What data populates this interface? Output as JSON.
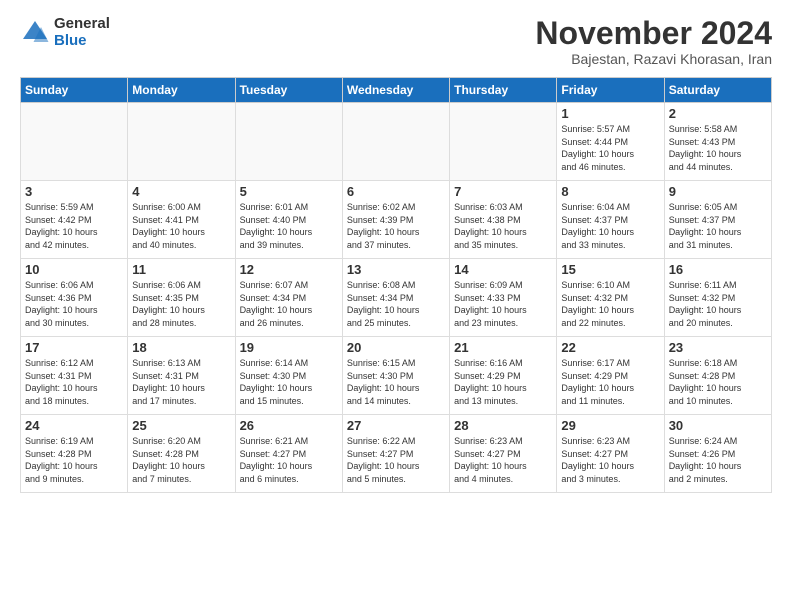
{
  "logo": {
    "general": "General",
    "blue": "Blue"
  },
  "header": {
    "month": "November 2024",
    "location": "Bajestan, Razavi Khorasan, Iran"
  },
  "weekdays": [
    "Sunday",
    "Monday",
    "Tuesday",
    "Wednesday",
    "Thursday",
    "Friday",
    "Saturday"
  ],
  "weeks": [
    [
      {
        "day": "",
        "info": ""
      },
      {
        "day": "",
        "info": ""
      },
      {
        "day": "",
        "info": ""
      },
      {
        "day": "",
        "info": ""
      },
      {
        "day": "",
        "info": ""
      },
      {
        "day": "1",
        "info": "Sunrise: 5:57 AM\nSunset: 4:44 PM\nDaylight: 10 hours\nand 46 minutes."
      },
      {
        "day": "2",
        "info": "Sunrise: 5:58 AM\nSunset: 4:43 PM\nDaylight: 10 hours\nand 44 minutes."
      }
    ],
    [
      {
        "day": "3",
        "info": "Sunrise: 5:59 AM\nSunset: 4:42 PM\nDaylight: 10 hours\nand 42 minutes."
      },
      {
        "day": "4",
        "info": "Sunrise: 6:00 AM\nSunset: 4:41 PM\nDaylight: 10 hours\nand 40 minutes."
      },
      {
        "day": "5",
        "info": "Sunrise: 6:01 AM\nSunset: 4:40 PM\nDaylight: 10 hours\nand 39 minutes."
      },
      {
        "day": "6",
        "info": "Sunrise: 6:02 AM\nSunset: 4:39 PM\nDaylight: 10 hours\nand 37 minutes."
      },
      {
        "day": "7",
        "info": "Sunrise: 6:03 AM\nSunset: 4:38 PM\nDaylight: 10 hours\nand 35 minutes."
      },
      {
        "day": "8",
        "info": "Sunrise: 6:04 AM\nSunset: 4:37 PM\nDaylight: 10 hours\nand 33 minutes."
      },
      {
        "day": "9",
        "info": "Sunrise: 6:05 AM\nSunset: 4:37 PM\nDaylight: 10 hours\nand 31 minutes."
      }
    ],
    [
      {
        "day": "10",
        "info": "Sunrise: 6:06 AM\nSunset: 4:36 PM\nDaylight: 10 hours\nand 30 minutes."
      },
      {
        "day": "11",
        "info": "Sunrise: 6:06 AM\nSunset: 4:35 PM\nDaylight: 10 hours\nand 28 minutes."
      },
      {
        "day": "12",
        "info": "Sunrise: 6:07 AM\nSunset: 4:34 PM\nDaylight: 10 hours\nand 26 minutes."
      },
      {
        "day": "13",
        "info": "Sunrise: 6:08 AM\nSunset: 4:34 PM\nDaylight: 10 hours\nand 25 minutes."
      },
      {
        "day": "14",
        "info": "Sunrise: 6:09 AM\nSunset: 4:33 PM\nDaylight: 10 hours\nand 23 minutes."
      },
      {
        "day": "15",
        "info": "Sunrise: 6:10 AM\nSunset: 4:32 PM\nDaylight: 10 hours\nand 22 minutes."
      },
      {
        "day": "16",
        "info": "Sunrise: 6:11 AM\nSunset: 4:32 PM\nDaylight: 10 hours\nand 20 minutes."
      }
    ],
    [
      {
        "day": "17",
        "info": "Sunrise: 6:12 AM\nSunset: 4:31 PM\nDaylight: 10 hours\nand 18 minutes."
      },
      {
        "day": "18",
        "info": "Sunrise: 6:13 AM\nSunset: 4:31 PM\nDaylight: 10 hours\nand 17 minutes."
      },
      {
        "day": "19",
        "info": "Sunrise: 6:14 AM\nSunset: 4:30 PM\nDaylight: 10 hours\nand 15 minutes."
      },
      {
        "day": "20",
        "info": "Sunrise: 6:15 AM\nSunset: 4:30 PM\nDaylight: 10 hours\nand 14 minutes."
      },
      {
        "day": "21",
        "info": "Sunrise: 6:16 AM\nSunset: 4:29 PM\nDaylight: 10 hours\nand 13 minutes."
      },
      {
        "day": "22",
        "info": "Sunrise: 6:17 AM\nSunset: 4:29 PM\nDaylight: 10 hours\nand 11 minutes."
      },
      {
        "day": "23",
        "info": "Sunrise: 6:18 AM\nSunset: 4:28 PM\nDaylight: 10 hours\nand 10 minutes."
      }
    ],
    [
      {
        "day": "24",
        "info": "Sunrise: 6:19 AM\nSunset: 4:28 PM\nDaylight: 10 hours\nand 9 minutes."
      },
      {
        "day": "25",
        "info": "Sunrise: 6:20 AM\nSunset: 4:28 PM\nDaylight: 10 hours\nand 7 minutes."
      },
      {
        "day": "26",
        "info": "Sunrise: 6:21 AM\nSunset: 4:27 PM\nDaylight: 10 hours\nand 6 minutes."
      },
      {
        "day": "27",
        "info": "Sunrise: 6:22 AM\nSunset: 4:27 PM\nDaylight: 10 hours\nand 5 minutes."
      },
      {
        "day": "28",
        "info": "Sunrise: 6:23 AM\nSunset: 4:27 PM\nDaylight: 10 hours\nand 4 minutes."
      },
      {
        "day": "29",
        "info": "Sunrise: 6:23 AM\nSunset: 4:27 PM\nDaylight: 10 hours\nand 3 minutes."
      },
      {
        "day": "30",
        "info": "Sunrise: 6:24 AM\nSunset: 4:26 PM\nDaylight: 10 hours\nand 2 minutes."
      }
    ]
  ]
}
